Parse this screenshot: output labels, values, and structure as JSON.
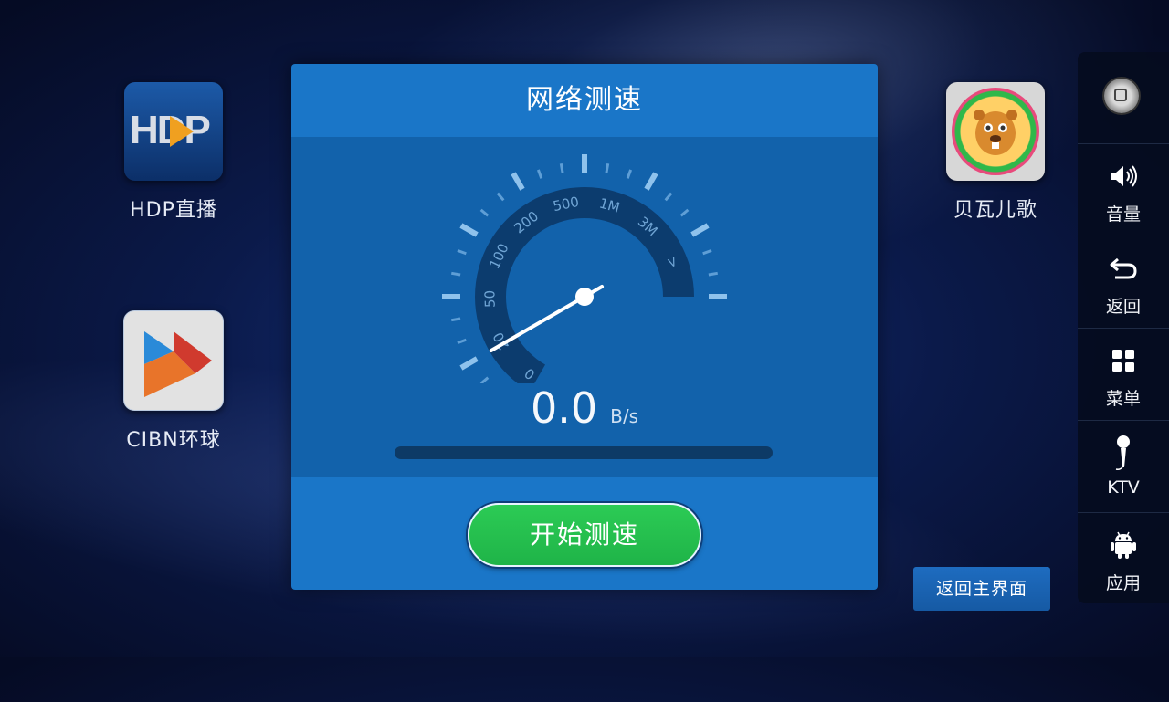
{
  "apps": [
    {
      "label": "HDP直播",
      "icon": "hdp-live-icon"
    },
    {
      "label": "CIBN环球",
      "icon": "cibn-global-icon"
    },
    {
      "label": "贝瓦儿歌",
      "icon": "beva-songs-icon"
    }
  ],
  "hdp_logo_text": "HDP",
  "dialog": {
    "title": "网络测速",
    "gauge_labels": [
      "0",
      "20",
      "50",
      "100",
      "200",
      "500",
      "1M",
      "3M",
      ">"
    ],
    "speed_value": "0.0",
    "speed_unit": "B/s",
    "progress": 0,
    "start_label": "开始测速"
  },
  "side_panel": {
    "home_icon": "home-button-icon",
    "items": [
      {
        "label": "音量",
        "icon": "volume-icon"
      },
      {
        "label": "返回",
        "icon": "back-icon"
      },
      {
        "label": "菜单",
        "icon": "menu-icon"
      },
      {
        "label": "KTV",
        "icon": "microphone-icon"
      },
      {
        "label": "应用",
        "icon": "android-icon"
      }
    ]
  },
  "back_home_label": "返回主界面",
  "colors": {
    "dialog_bg": "#1a76c8",
    "dialog_body_bg": "#1262ab",
    "start_button": "#22c04e",
    "side_panel_bg": "#050c1e"
  }
}
